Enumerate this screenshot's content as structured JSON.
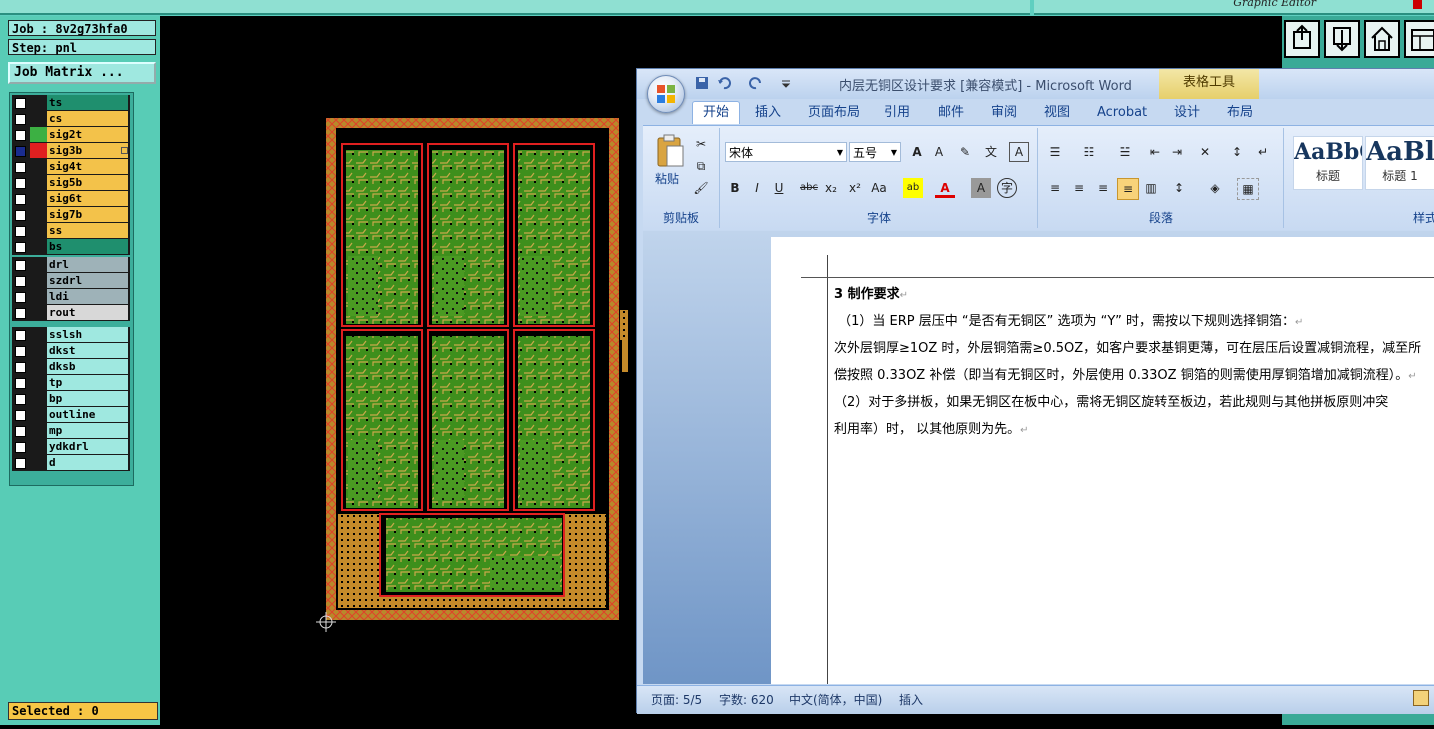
{
  "cam": {
    "header_title": "Graphic Editor",
    "job": "Job : 8v2g73hfa0",
    "step": "Step: pnl",
    "job_matrix_button": "Job Matrix ...",
    "selected": "Selected : 0",
    "layers_signal": [
      {
        "name": "ts",
        "color": "#1f8f6e",
        "swatch": "#1a1a1a"
      },
      {
        "name": "cs",
        "color": "#f3c24a",
        "swatch": "#1a1a1a"
      },
      {
        "name": "sig2t",
        "color": "#f3c24a",
        "swatch": "#3cb043"
      },
      {
        "name": "sig3b",
        "color": "#f3c24a",
        "swatch": "#e02020"
      },
      {
        "name": "sig4t",
        "color": "#f3c24a",
        "swatch": "#1a1a1a"
      },
      {
        "name": "sig5b",
        "color": "#f3c24a",
        "swatch": "#1a1a1a"
      },
      {
        "name": "sig6t",
        "color": "#f3c24a",
        "swatch": "#1a1a1a"
      },
      {
        "name": "sig7b",
        "color": "#f3c24a",
        "swatch": "#1a1a1a"
      },
      {
        "name": "ss",
        "color": "#f3c24a",
        "swatch": "#1a1a1a"
      },
      {
        "name": "bs",
        "color": "#1f8f6e",
        "swatch": "#1a1a1a"
      }
    ],
    "layers_drill": [
      {
        "name": "drl",
        "color": "#9eb2b8",
        "swatch": "#1a1a1a"
      },
      {
        "name": "szdrl",
        "color": "#9eb2b8",
        "swatch": "#1a1a1a"
      },
      {
        "name": "ldi",
        "color": "#9eb2b8",
        "swatch": "#1a1a1a"
      },
      {
        "name": "rout",
        "color": "#d8d8d8",
        "swatch": "#1a1a1a"
      }
    ],
    "layers_misc": [
      {
        "name": "sslsh",
        "color": "#9fe8e0",
        "swatch": "#1a1a1a"
      },
      {
        "name": "dkst",
        "color": "#9fe8e0",
        "swatch": "#1a1a1a"
      },
      {
        "name": "dksb",
        "color": "#9fe8e0",
        "swatch": "#1a1a1a"
      },
      {
        "name": "tp",
        "color": "#9fe8e0",
        "swatch": "#1a1a1a"
      },
      {
        "name": "bp",
        "color": "#9fe8e0",
        "swatch": "#1a1a1a"
      },
      {
        "name": "outline",
        "color": "#9fe8e0",
        "swatch": "#1a1a1a"
      },
      {
        "name": "mp",
        "color": "#9fe8e0",
        "swatch": "#1a1a1a"
      },
      {
        "name": "ydkdrl",
        "color": "#9fe8e0",
        "swatch": "#1a1a1a"
      },
      {
        "name": "d",
        "color": "#9fe8e0",
        "swatch": "#1a1a1a"
      }
    ],
    "tool_icons": [
      "save-out-icon",
      "save-in-icon",
      "home-icon",
      "window-icon"
    ]
  },
  "word": {
    "title": "内层无铜区设计要求 [兼容模式] - Microsoft Word",
    "context_tab_title": "表格工具",
    "tabs": [
      "开始",
      "插入",
      "页面布局",
      "引用",
      "邮件",
      "审阅",
      "视图",
      "Acrobat",
      "设计",
      "布局"
    ],
    "active_tab": "开始",
    "clipboard": {
      "paste": "粘贴",
      "label": "剪贴板"
    },
    "font_group": {
      "font_name": "宋体",
      "font_size": "五号",
      "label": "字体"
    },
    "paragraph_group": {
      "label": "段落"
    },
    "styles_group": {
      "label": "样式",
      "items": [
        {
          "sample": "AaBbC",
          "name": "标题"
        },
        {
          "sample": "AaBl",
          "name": "标题 1"
        }
      ]
    },
    "document": {
      "heading_num": "3",
      "heading": "制作要求",
      "lines": [
        "（1）当 ERP 层压中 “是否有无铜区” 选项为 “Y” 时，需按以下规则选择铜箔：",
        "次外层铜厚≥1OZ 时，外层铜箔需≥0.5OZ，如客户要求基铜更薄，可在层压后设置减铜流程，减至所",
        "偿按照 0.33OZ 补偿（即当有无铜区时，外层使用 0.33OZ 铜箔的则需使用厚铜箔增加减铜流程）。",
        "（2）对于多拼板，如果无铜区在板中心，需将无铜区旋转至板边，若此规则与其他拼板原则冲突",
        "利用率）时， 以其他原则为先。"
      ]
    },
    "status": {
      "page": "页面: 5/5",
      "words": "字数: 620",
      "language": "中文(简体，中国)",
      "mode": "插入"
    }
  }
}
